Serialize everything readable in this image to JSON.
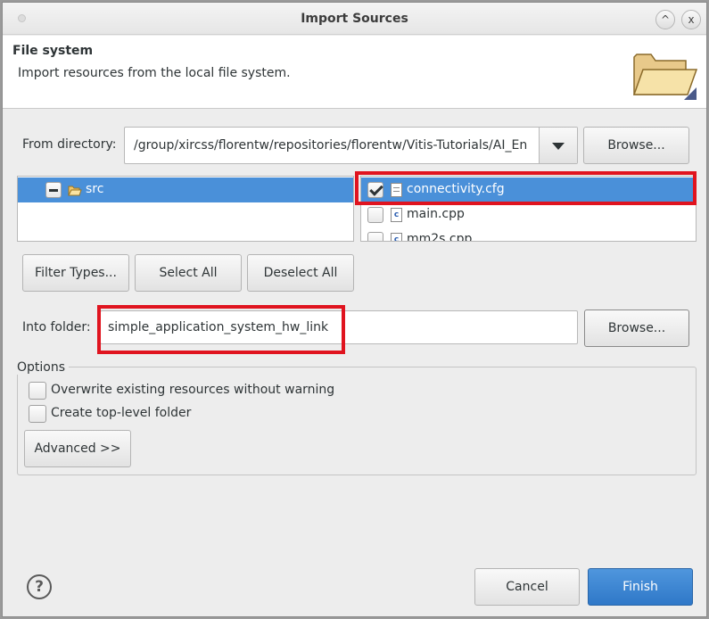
{
  "window": {
    "title": "Import Sources",
    "maximize_glyph": "^",
    "close_glyph": "x"
  },
  "header": {
    "title": "File system",
    "description": "Import resources from the local file system.",
    "icon": "folder-icon"
  },
  "from_directory": {
    "label": "From directory:",
    "value": "/group/xircss/florentw/repositories/florentw/Vitis-Tutorials/AI_En",
    "browse_label": "Browse..."
  },
  "folder_tree": {
    "items": [
      {
        "label": "src",
        "check_state": "partial",
        "selected": true
      }
    ]
  },
  "file_list": {
    "items": [
      {
        "label": "connectivity.cfg",
        "checked": true,
        "selected": true,
        "icon": "text-file-icon"
      },
      {
        "label": "main.cpp",
        "checked": false,
        "selected": false,
        "icon": "cpp-file-icon"
      },
      {
        "label": "mm2s.cpp",
        "checked": false,
        "selected": false,
        "icon": "cpp-file-icon"
      }
    ]
  },
  "actions": {
    "filter_types": "Filter Types...",
    "select_all": "Select All",
    "deselect_all": "Deselect All"
  },
  "into_folder": {
    "label": "Into folder:",
    "value": "simple_application_system_hw_link",
    "browse_label": "Browse..."
  },
  "options": {
    "title": "Options",
    "overwrite_label": "Overwrite existing resources without warning",
    "overwrite_checked": false,
    "create_top_level_label": "Create top-level folder",
    "create_top_level_checked": false,
    "advanced_label": "Advanced >>"
  },
  "footer": {
    "help_glyph": "?",
    "cancel_label": "Cancel",
    "finish_label": "Finish"
  },
  "colors": {
    "selection": "#4a90d9",
    "highlight_box": "#e0141f",
    "finish_button": "#3a82d0"
  }
}
